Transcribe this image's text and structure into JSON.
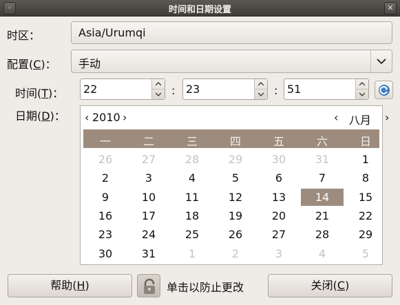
{
  "window": {
    "title": "时间和日期设置"
  },
  "labels": {
    "timezone": "时区：",
    "config_pre": "配置(",
    "config_key": "C",
    "config_post": ")：",
    "time_pre": "时间(",
    "time_key": "T",
    "time_post": ")：",
    "date_pre": "日期(",
    "date_key": "D",
    "date_post": ")："
  },
  "timezone": {
    "value": "Asia/Urumqi"
  },
  "config": {
    "value": "手动"
  },
  "time": {
    "hour": "22",
    "minute": "23",
    "second": "51",
    "separator": ":"
  },
  "calendar": {
    "year": "2010",
    "month": "八月",
    "prev_year": "‹",
    "next_year": "›",
    "prev_month": "‹",
    "next_month": "›",
    "weekdays": [
      "一",
      "二",
      "三",
      "四",
      "五",
      "六",
      "日"
    ],
    "weeks": [
      [
        "26",
        "27",
        "28",
        "29",
        "30",
        "31",
        "1"
      ],
      [
        "2",
        "3",
        "4",
        "5",
        "6",
        "7",
        "8"
      ],
      [
        "9",
        "10",
        "11",
        "12",
        "13",
        "14",
        "15"
      ],
      [
        "16",
        "17",
        "18",
        "19",
        "20",
        "21",
        "22"
      ],
      [
        "23",
        "24",
        "25",
        "26",
        "27",
        "28",
        "29"
      ],
      [
        "30",
        "31",
        "1",
        "2",
        "3",
        "4",
        "5"
      ]
    ],
    "selected": "14"
  },
  "buttons": {
    "help_pre": "帮助(",
    "help_key": "H",
    "help_post": ")",
    "lock_text": "单击以防止更改",
    "close_pre": "关闭(",
    "close_key": "C",
    "close_post": ")"
  },
  "colors": {
    "accent": "#9d8c7e",
    "background": "#efebe7"
  }
}
